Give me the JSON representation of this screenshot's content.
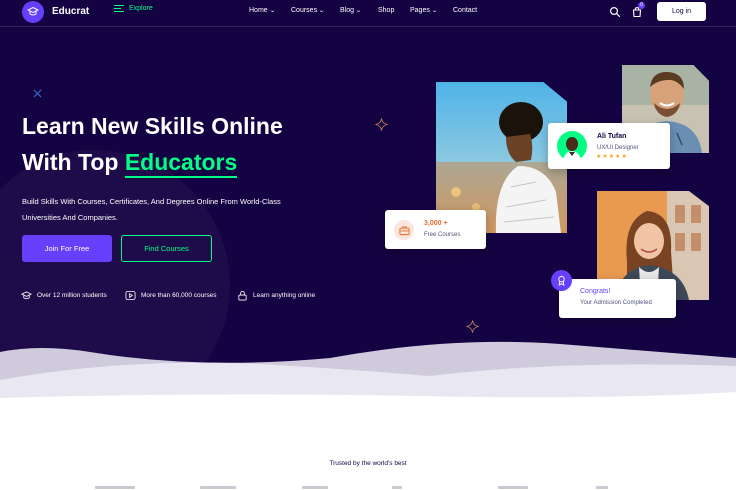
{
  "header": {
    "brand": "Educrat",
    "explore_label": "Explore",
    "nav": [
      {
        "label": "Home",
        "has_dropdown": true
      },
      {
        "label": "Courses",
        "has_dropdown": true
      },
      {
        "label": "Blog",
        "has_dropdown": true
      },
      {
        "label": "Shop",
        "has_dropdown": false
      },
      {
        "label": "Pages",
        "has_dropdown": true
      },
      {
        "label": "Contact",
        "has_dropdown": false
      }
    ],
    "cart_count": "0",
    "login_label": "Log in",
    "icons": [
      "search-icon",
      "cart-icon"
    ]
  },
  "hero": {
    "headline_line1": "Learn New Skills Online",
    "headline_line2_prefix": "With Top",
    "headline_accent": "Educators",
    "subtext": "Build Skills With Courses, Certificates, And Degrees Online From World-Class Universities And Companies.",
    "primary_cta": "Join For Free",
    "secondary_cta": "Find Courses",
    "features": [
      {
        "icon": "graduation-cap-icon",
        "label": "Over 12 million students"
      },
      {
        "icon": "play-video-icon",
        "label": "More than 60,000 courses"
      },
      {
        "icon": "lock-icon",
        "label": "Learn anything online"
      }
    ]
  },
  "cards": {
    "instructor": {
      "name": "Ali Tufan",
      "role": "UX/UI Designer",
      "rating": 5
    },
    "courses": {
      "count": "3,000 +",
      "label": "Free Courses"
    },
    "admission": {
      "title": "Congrats!",
      "label": "Your Admission Completed"
    }
  },
  "trusted_label": "Trusted by the world's best",
  "colors": {
    "background": "#140342",
    "accent_purple": "#6440fb",
    "accent_green": "#00ff84",
    "orange": "#e8692c",
    "star": "#f5a623"
  }
}
